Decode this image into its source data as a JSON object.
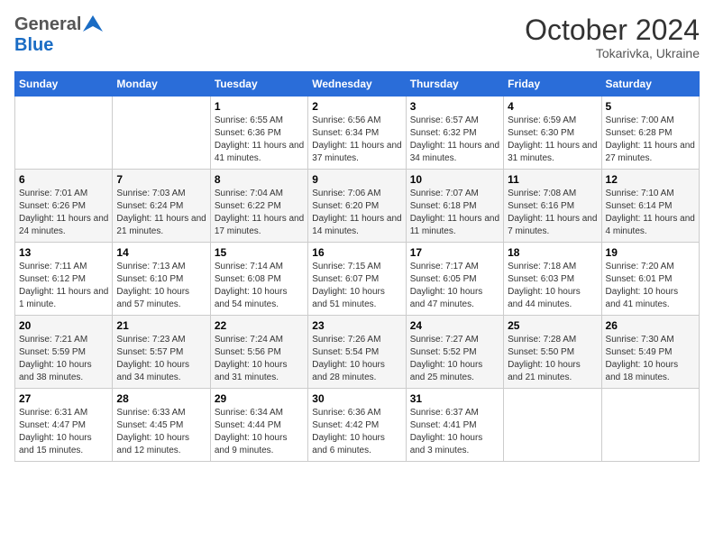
{
  "header": {
    "logo_general": "General",
    "logo_blue": "Blue",
    "month": "October 2024",
    "location": "Tokarivka, Ukraine"
  },
  "weekdays": [
    "Sunday",
    "Monday",
    "Tuesday",
    "Wednesday",
    "Thursday",
    "Friday",
    "Saturday"
  ],
  "weeks": [
    [
      {
        "day": "",
        "sunrise": "",
        "sunset": "",
        "daylight": ""
      },
      {
        "day": "",
        "sunrise": "",
        "sunset": "",
        "daylight": ""
      },
      {
        "day": "1",
        "sunrise": "Sunrise: 6:55 AM",
        "sunset": "Sunset: 6:36 PM",
        "daylight": "Daylight: 11 hours and 41 minutes."
      },
      {
        "day": "2",
        "sunrise": "Sunrise: 6:56 AM",
        "sunset": "Sunset: 6:34 PM",
        "daylight": "Daylight: 11 hours and 37 minutes."
      },
      {
        "day": "3",
        "sunrise": "Sunrise: 6:57 AM",
        "sunset": "Sunset: 6:32 PM",
        "daylight": "Daylight: 11 hours and 34 minutes."
      },
      {
        "day": "4",
        "sunrise": "Sunrise: 6:59 AM",
        "sunset": "Sunset: 6:30 PM",
        "daylight": "Daylight: 11 hours and 31 minutes."
      },
      {
        "day": "5",
        "sunrise": "Sunrise: 7:00 AM",
        "sunset": "Sunset: 6:28 PM",
        "daylight": "Daylight: 11 hours and 27 minutes."
      }
    ],
    [
      {
        "day": "6",
        "sunrise": "Sunrise: 7:01 AM",
        "sunset": "Sunset: 6:26 PM",
        "daylight": "Daylight: 11 hours and 24 minutes."
      },
      {
        "day": "7",
        "sunrise": "Sunrise: 7:03 AM",
        "sunset": "Sunset: 6:24 PM",
        "daylight": "Daylight: 11 hours and 21 minutes."
      },
      {
        "day": "8",
        "sunrise": "Sunrise: 7:04 AM",
        "sunset": "Sunset: 6:22 PM",
        "daylight": "Daylight: 11 hours and 17 minutes."
      },
      {
        "day": "9",
        "sunrise": "Sunrise: 7:06 AM",
        "sunset": "Sunset: 6:20 PM",
        "daylight": "Daylight: 11 hours and 14 minutes."
      },
      {
        "day": "10",
        "sunrise": "Sunrise: 7:07 AM",
        "sunset": "Sunset: 6:18 PM",
        "daylight": "Daylight: 11 hours and 11 minutes."
      },
      {
        "day": "11",
        "sunrise": "Sunrise: 7:08 AM",
        "sunset": "Sunset: 6:16 PM",
        "daylight": "Daylight: 11 hours and 7 minutes."
      },
      {
        "day": "12",
        "sunrise": "Sunrise: 7:10 AM",
        "sunset": "Sunset: 6:14 PM",
        "daylight": "Daylight: 11 hours and 4 minutes."
      }
    ],
    [
      {
        "day": "13",
        "sunrise": "Sunrise: 7:11 AM",
        "sunset": "Sunset: 6:12 PM",
        "daylight": "Daylight: 11 hours and 1 minute."
      },
      {
        "day": "14",
        "sunrise": "Sunrise: 7:13 AM",
        "sunset": "Sunset: 6:10 PM",
        "daylight": "Daylight: 10 hours and 57 minutes."
      },
      {
        "day": "15",
        "sunrise": "Sunrise: 7:14 AM",
        "sunset": "Sunset: 6:08 PM",
        "daylight": "Daylight: 10 hours and 54 minutes."
      },
      {
        "day": "16",
        "sunrise": "Sunrise: 7:15 AM",
        "sunset": "Sunset: 6:07 PM",
        "daylight": "Daylight: 10 hours and 51 minutes."
      },
      {
        "day": "17",
        "sunrise": "Sunrise: 7:17 AM",
        "sunset": "Sunset: 6:05 PM",
        "daylight": "Daylight: 10 hours and 47 minutes."
      },
      {
        "day": "18",
        "sunrise": "Sunrise: 7:18 AM",
        "sunset": "Sunset: 6:03 PM",
        "daylight": "Daylight: 10 hours and 44 minutes."
      },
      {
        "day": "19",
        "sunrise": "Sunrise: 7:20 AM",
        "sunset": "Sunset: 6:01 PM",
        "daylight": "Daylight: 10 hours and 41 minutes."
      }
    ],
    [
      {
        "day": "20",
        "sunrise": "Sunrise: 7:21 AM",
        "sunset": "Sunset: 5:59 PM",
        "daylight": "Daylight: 10 hours and 38 minutes."
      },
      {
        "day": "21",
        "sunrise": "Sunrise: 7:23 AM",
        "sunset": "Sunset: 5:57 PM",
        "daylight": "Daylight: 10 hours and 34 minutes."
      },
      {
        "day": "22",
        "sunrise": "Sunrise: 7:24 AM",
        "sunset": "Sunset: 5:56 PM",
        "daylight": "Daylight: 10 hours and 31 minutes."
      },
      {
        "day": "23",
        "sunrise": "Sunrise: 7:26 AM",
        "sunset": "Sunset: 5:54 PM",
        "daylight": "Daylight: 10 hours and 28 minutes."
      },
      {
        "day": "24",
        "sunrise": "Sunrise: 7:27 AM",
        "sunset": "Sunset: 5:52 PM",
        "daylight": "Daylight: 10 hours and 25 minutes."
      },
      {
        "day": "25",
        "sunrise": "Sunrise: 7:28 AM",
        "sunset": "Sunset: 5:50 PM",
        "daylight": "Daylight: 10 hours and 21 minutes."
      },
      {
        "day": "26",
        "sunrise": "Sunrise: 7:30 AM",
        "sunset": "Sunset: 5:49 PM",
        "daylight": "Daylight: 10 hours and 18 minutes."
      }
    ],
    [
      {
        "day": "27",
        "sunrise": "Sunrise: 6:31 AM",
        "sunset": "Sunset: 4:47 PM",
        "daylight": "Daylight: 10 hours and 15 minutes."
      },
      {
        "day": "28",
        "sunrise": "Sunrise: 6:33 AM",
        "sunset": "Sunset: 4:45 PM",
        "daylight": "Daylight: 10 hours and 12 minutes."
      },
      {
        "day": "29",
        "sunrise": "Sunrise: 6:34 AM",
        "sunset": "Sunset: 4:44 PM",
        "daylight": "Daylight: 10 hours and 9 minutes."
      },
      {
        "day": "30",
        "sunrise": "Sunrise: 6:36 AM",
        "sunset": "Sunset: 4:42 PM",
        "daylight": "Daylight: 10 hours and 6 minutes."
      },
      {
        "day": "31",
        "sunrise": "Sunrise: 6:37 AM",
        "sunset": "Sunset: 4:41 PM",
        "daylight": "Daylight: 10 hours and 3 minutes."
      },
      {
        "day": "",
        "sunrise": "",
        "sunset": "",
        "daylight": ""
      },
      {
        "day": "",
        "sunrise": "",
        "sunset": "",
        "daylight": ""
      }
    ]
  ]
}
